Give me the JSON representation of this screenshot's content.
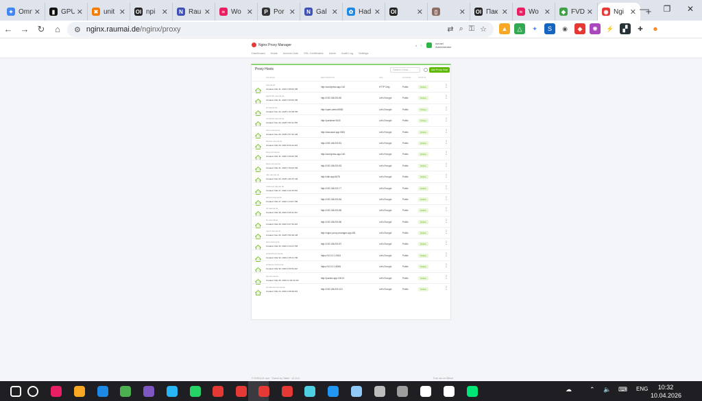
{
  "browser": {
    "tabs": [
      {
        "title": "Omn",
        "color": "#4285f4",
        "glyph": "✦"
      },
      {
        "title": "GPU",
        "color": "#111111",
        "glyph": "▮"
      },
      {
        "title": "unit",
        "color": "#f57c00",
        "glyph": "✖"
      },
      {
        "title": "npi",
        "color": "#222222",
        "glyph": "OI"
      },
      {
        "title": "Rau",
        "color": "#3f51b5",
        "glyph": "N"
      },
      {
        "title": "Wo",
        "color": "#e91e63",
        "glyph": "≈"
      },
      {
        "title": "Por",
        "color": "#333333",
        "glyph": "P"
      },
      {
        "title": "Gal",
        "color": "#3f51b5",
        "glyph": "N"
      },
      {
        "title": "Had",
        "color": "#1e88e5",
        "glyph": "✿"
      },
      {
        "title": "",
        "color": "#222222",
        "glyph": "OI"
      },
      {
        "title": "",
        "color": "#8d6e63",
        "glyph": "▯"
      },
      {
        "title": "Пак",
        "color": "#222222",
        "glyph": "OI"
      },
      {
        "title": "Wo",
        "color": "#e91e63",
        "glyph": "≈"
      },
      {
        "title": "FVD",
        "color": "#43a047",
        "glyph": "◆"
      },
      {
        "title": "Ngi",
        "color": "#e53935",
        "glyph": "◉",
        "active": true
      }
    ],
    "url_host": "nginx.raumai.de",
    "url_path": "/nginx/proxy"
  },
  "app": {
    "brand": "Nginx Proxy Manager",
    "user_name": "Ismael",
    "user_role": "Administrator",
    "nav": [
      "Dashboard",
      "Hosts",
      "Access Lists",
      "SSL Certificates",
      "Users",
      "Audit Log",
      "Settings"
    ],
    "card_title": "Proxy Hosts",
    "search_placeholder": "Search Host…",
    "add_button": "Add Proxy Host",
    "columns": {
      "source": "SOURCE",
      "destination": "DESTINATION",
      "ssl": "SSL",
      "access": "ACCESS",
      "status": "STATUS"
    },
    "hosts": [
      {
        "source": "raumai.de",
        "created": "Created: Mar 31, 2026 3:38:00 PM",
        "dest": "http://wordpress-app:140",
        "ssl": "HTTP Only",
        "access": "Public",
        "status": "Online"
      },
      {
        "source": "appsmith.raumai.de",
        "created": "Created: Mar 31, 2026 3:43:00 PM",
        "dest": "http://192.168.200.80",
        "ssl": "Let's Encrypt",
        "access": "Public",
        "status": "Online"
      },
      {
        "source": "ai.raumai.de",
        "created": "Created: Dec 20, 2025 1:23:05 PM",
        "dest": "http://open-webui:8080",
        "ssl": "Let's Encrypt",
        "access": "Public",
        "status": "Online"
      },
      {
        "source": "container.raumai.de",
        "created": "Created: Dec 20, 2025 3:00:11 PM",
        "dest": "http://portainer:9443",
        "ssl": "Let's Encrypt",
        "access": "Public",
        "status": "Online"
      },
      {
        "source": "docs.raumai.de",
        "created": "Created: Dec 20, 2025 2:57:42 AM",
        "dest": "http://docuseal-app:3000",
        "ssl": "Let's Encrypt",
        "access": "Public",
        "status": "Online"
      },
      {
        "source": "flowise.raumai.de",
        "created": "Created: Mar 29, 2026 8:26:44 AM",
        "dest": "http://192.168.200.81",
        "ssl": "Let's Encrypt",
        "access": "Public",
        "status": "Online"
      },
      {
        "source": "blog.raumai.de",
        "created": "Created: Mar 31, 2026 4:29:00 PM",
        "dest": "http://wordpress-app:140",
        "ssl": "Let's Encrypt",
        "access": "Public",
        "status": "Online"
      },
      {
        "source": "flows.raumai.de",
        "created": "Created: Mar 31, 2026 7:00:00 PM",
        "dest": "http://192.168.200.83",
        "ssl": "Let's Encrypt",
        "access": "Public",
        "status": "Online"
      },
      {
        "source": "n8n.raumai.de",
        "created": "Created: Dec 20, 2025 4:36:37 AM",
        "dest": "http://n8n-app:5678",
        "ssl": "Let's Encrypt",
        "access": "Public",
        "status": "Online"
      },
      {
        "source": "node-red.raumai.de",
        "created": "Created: Mar 27, 2026 4:11:26 PM",
        "dest": "http://192.168.200.77",
        "ssl": "Let's Encrypt",
        "access": "Public",
        "status": "Online"
      },
      {
        "source": "qdrant.raumai.de",
        "created": "Created: Mar 27, 2026 4:14:07 PM",
        "dest": "http://192.168.200.84",
        "ssl": "Let's Encrypt",
        "access": "Public",
        "status": "Online"
      },
      {
        "source": "s3.raumai.de",
        "created": "Created: Mar 28, 2026 9:40:11 AM",
        "dest": "http://192.168.200.85",
        "ssl": "Let's Encrypt",
        "access": "Public",
        "status": "Online"
      },
      {
        "source": "sb.raumai.de",
        "created": "Created: Mar 28, 2026 9:47:32 AM",
        "dest": "http://192.168.200.86",
        "ssl": "Let's Encrypt",
        "access": "Public",
        "status": "Online"
      },
      {
        "source": "nginx.raumai.de",
        "created": "Created: Dec 20, 2025 3:50:00 AM",
        "dest": "http://nginx-proxy-manager-app:181",
        "ssl": "Let's Encrypt",
        "access": "Public",
        "status": "Online"
      },
      {
        "source": "spin.raumai.de",
        "created": "Created: Mar 26, 2026 2:44:21 PM",
        "dest": "http://192.168.200.87",
        "ssl": "Let's Encrypt",
        "access": "Public",
        "status": "Online"
      },
      {
        "source": "windmill.raumai.de",
        "created": "Created: Mar 30, 2026 1:05:21 PM",
        "dest": "https://10.0.0.1:9443",
        "ssl": "Let's Encrypt",
        "access": "Public",
        "status": "Online"
      },
      {
        "source": "windows.raumai.de",
        "created": "Created: Mar 30, 2026 3:20:54 AM",
        "dest": "https://10.0.0.1:8006",
        "ssl": "Let's Encrypt",
        "access": "Public",
        "status": "Online"
      },
      {
        "source": "wp.raumai.de",
        "created": "Created: Mar 28, 2026 11:18:43 AM",
        "dest": "http://portain-app:10013",
        "ssl": "Let's Encrypt",
        "access": "Public",
        "status": "Online"
      },
      {
        "source": "wordpress.raumai.de",
        "created": "Created: Mar 24, 2026 4:28:38 AM",
        "dest": "http://192.168.200.121",
        "ssl": "Let's Encrypt",
        "access": "Public",
        "status": "Online"
      }
    ],
    "footer_left": "© 2026 jc21.com · Theme by Tabler · v2.14.0",
    "footer_right": "Fork me on Github"
  },
  "taskbar": {
    "lang": "ENG",
    "time": "10:32",
    "date": "10.04.2026"
  }
}
